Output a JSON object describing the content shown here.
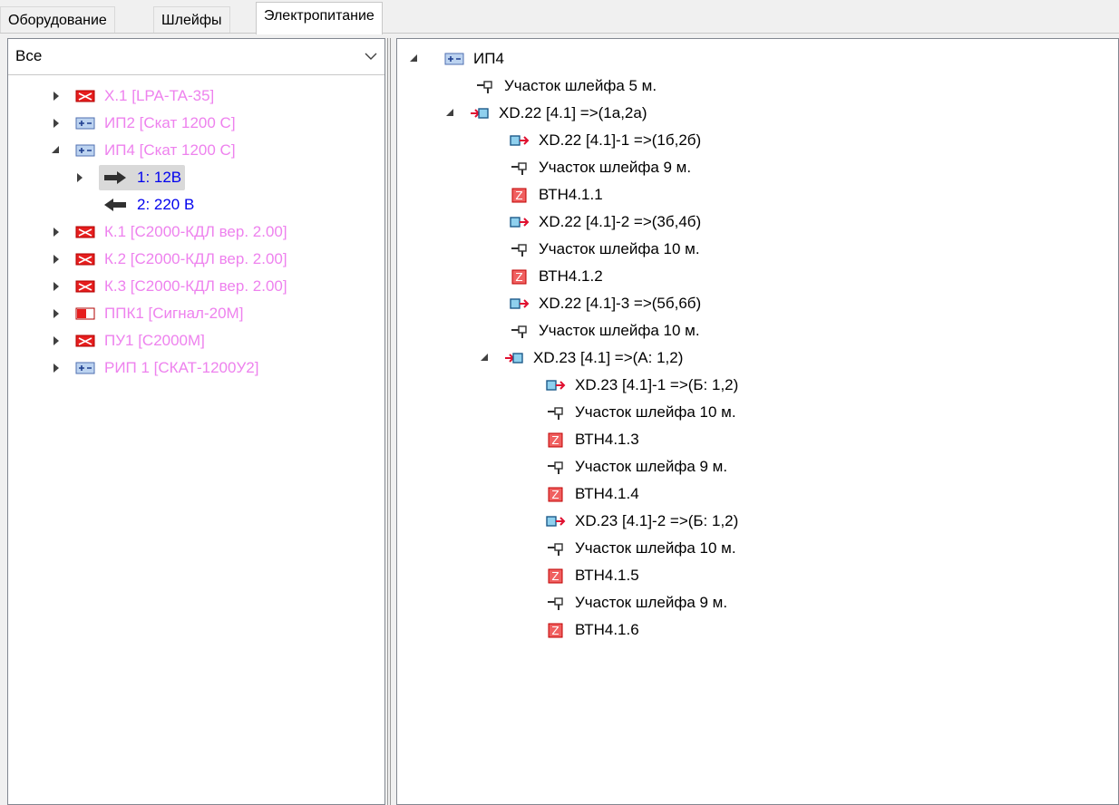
{
  "tabs": [
    "Оборудование",
    "Шлейфы",
    "Электропитание"
  ],
  "filter": {
    "value": "Все"
  },
  "left_tree": [
    {
      "label": "X.1 [LPA-TA-35]",
      "icon": "device-red-icon"
    },
    {
      "label": "ИП2 [Скат 1200 С]",
      "icon": "power-supply-icon"
    },
    {
      "label": "ИП4 [Скат 1200 С]",
      "icon": "power-supply-icon"
    },
    {
      "label": "1: 12В",
      "icon": "arrow-right-icon"
    },
    {
      "label": "2: 220 В",
      "icon": "arrow-left-icon"
    },
    {
      "label": "К.1 [С2000-КДЛ вер. 2.00]",
      "icon": "device-red-icon"
    },
    {
      "label": "К.2 [С2000-КДЛ вер. 2.00]",
      "icon": "device-red-icon"
    },
    {
      "label": "К.3 [С2000-КДЛ вер. 2.00]",
      "icon": "device-red-icon"
    },
    {
      "label": "ППК1 [Сигнал-20М]",
      "icon": "panel-icon"
    },
    {
      "label": "ПУ1 [С2000М]",
      "icon": "device-red-icon"
    },
    {
      "label": "РИП 1 [СКАТ-1200У2]",
      "icon": "power-supply-icon"
    }
  ],
  "right_tree": [
    {
      "label": "ИП4",
      "icon": "power-supply-icon"
    },
    {
      "label": "Участок шлейфа 5 м.",
      "icon": "cable-segment-icon"
    },
    {
      "label": "XD.22 [4.1] =>(1а,2а)",
      "icon": "terminal-in-icon"
    },
    {
      "label": "XD.22 [4.1]-1 =>(1б,2б)",
      "icon": "terminal-out-icon"
    },
    {
      "label": "Участок шлейфа 9 м.",
      "icon": "cable-segment-icon"
    },
    {
      "label": "ВТН4.1.1",
      "icon": "sensor-z-icon"
    },
    {
      "label": "XD.22 [4.1]-2 =>(3б,4б)",
      "icon": "terminal-out-icon"
    },
    {
      "label": "Участок шлейфа 10 м.",
      "icon": "cable-segment-icon"
    },
    {
      "label": "ВТН4.1.2",
      "icon": "sensor-z-icon"
    },
    {
      "label": "XD.22 [4.1]-3 =>(5б,6б)",
      "icon": "terminal-out-icon"
    },
    {
      "label": "Участок шлейфа 10 м.",
      "icon": "cable-segment-icon"
    },
    {
      "label": "XD.23 [4.1] =>(А: 1,2)",
      "icon": "terminal-in-icon"
    },
    {
      "label": "XD.23 [4.1]-1 =>(Б: 1,2)",
      "icon": "terminal-out-icon"
    },
    {
      "label": "Участок шлейфа 10 м.",
      "icon": "cable-segment-icon"
    },
    {
      "label": "ВТН4.1.3",
      "icon": "sensor-z-icon"
    },
    {
      "label": "Участок шлейфа 9 м.",
      "icon": "cable-segment-icon"
    },
    {
      "label": "ВТН4.1.4",
      "icon": "sensor-z-icon"
    },
    {
      "label": "XD.23 [4.1]-2 =>(Б: 1,2)",
      "icon": "terminal-out-icon"
    },
    {
      "label": "Участок шлейфа 10 м.",
      "icon": "cable-segment-icon"
    },
    {
      "label": "ВТН4.1.5",
      "icon": "sensor-z-icon"
    },
    {
      "label": "Участок шлейфа 9 м.",
      "icon": "cable-segment-icon"
    },
    {
      "label": "ВТН4.1.6",
      "icon": "sensor-z-icon"
    }
  ],
  "colors": {
    "link_pink": "#ee82ee",
    "link_blue": "#0000ee",
    "selection": "#d9d9d9"
  }
}
